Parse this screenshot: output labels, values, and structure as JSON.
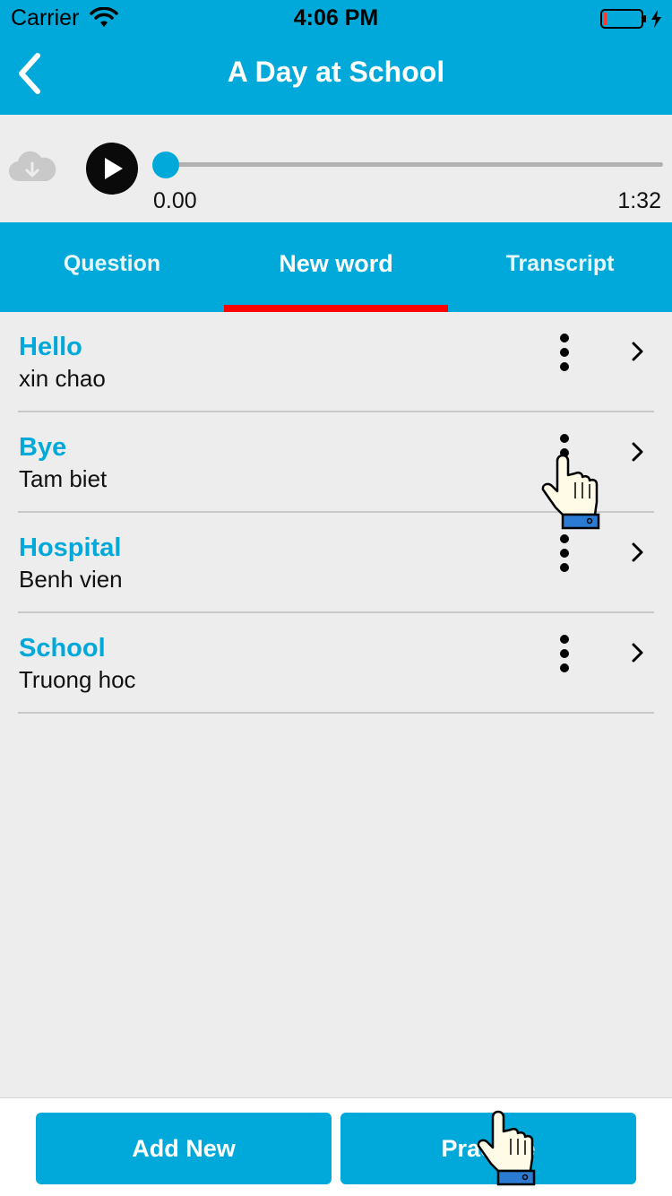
{
  "status_bar": {
    "carrier": "Carrier",
    "time": "4:06 PM"
  },
  "nav": {
    "title": "A Day at School"
  },
  "player": {
    "current_time": "0.00",
    "duration": "1:32",
    "progress": 0
  },
  "tabs": [
    {
      "label": "Question",
      "active": false
    },
    {
      "label": "New word",
      "active": true
    },
    {
      "label": "Transcript",
      "active": false
    }
  ],
  "words": [
    {
      "word": "Hello",
      "meaning": "xin chao"
    },
    {
      "word": "Bye",
      "meaning": "Tam biet"
    },
    {
      "word": "Hospital",
      "meaning": "Benh vien"
    },
    {
      "word": "School",
      "meaning": "Truong hoc"
    }
  ],
  "buttons": {
    "add_new": "Add New",
    "practice": "Practice"
  },
  "colors": {
    "accent": "#00a9d9",
    "tab_indicator": "#ff0000",
    "background": "#ededed"
  }
}
